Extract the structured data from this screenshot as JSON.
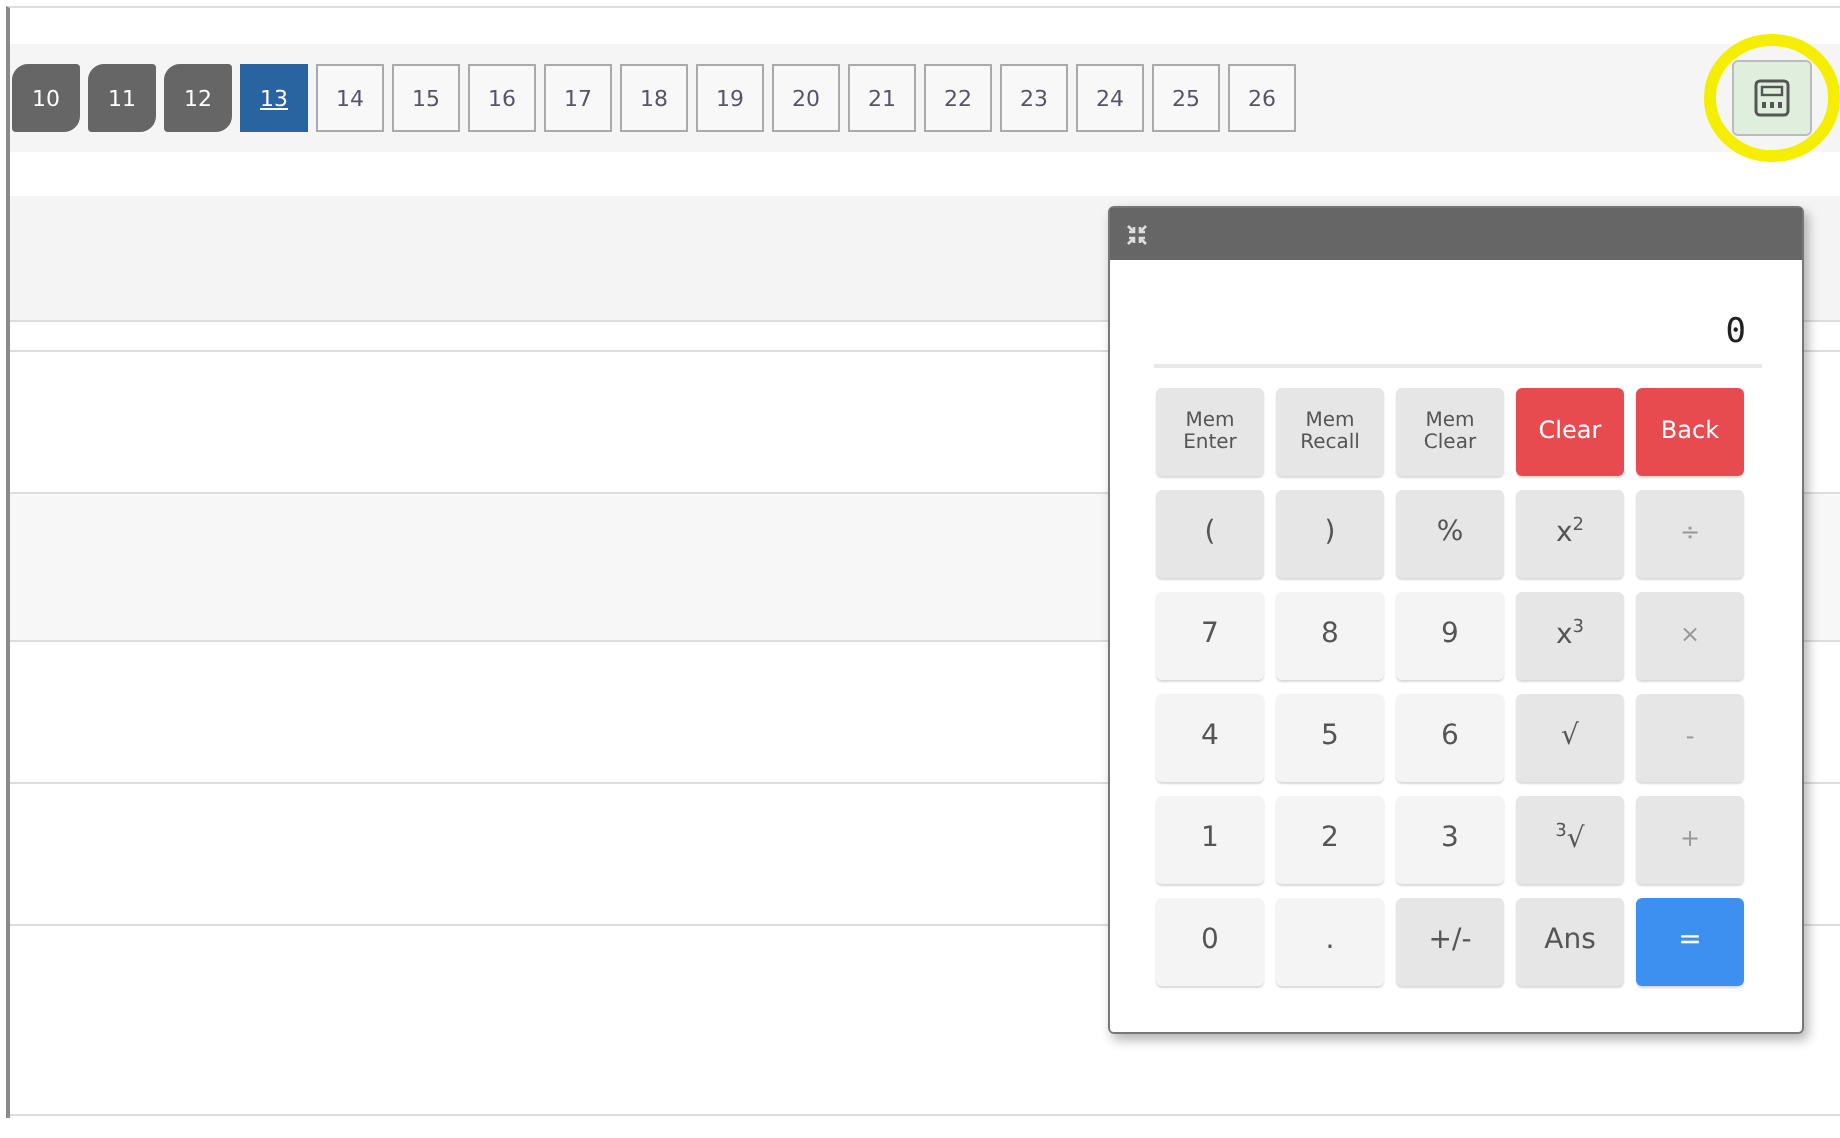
{
  "pages": [
    {
      "label": "10",
      "answered": true,
      "selected": false
    },
    {
      "label": "11",
      "answered": true,
      "selected": false
    },
    {
      "label": "12",
      "answered": true,
      "selected": false
    },
    {
      "label": "13",
      "answered": false,
      "selected": true
    },
    {
      "label": "14",
      "answered": false,
      "selected": false
    },
    {
      "label": "15",
      "answered": false,
      "selected": false
    },
    {
      "label": "16",
      "answered": false,
      "selected": false
    },
    {
      "label": "17",
      "answered": false,
      "selected": false
    },
    {
      "label": "18",
      "answered": false,
      "selected": false
    },
    {
      "label": "19",
      "answered": false,
      "selected": false
    },
    {
      "label": "20",
      "answered": false,
      "selected": false
    },
    {
      "label": "21",
      "answered": false,
      "selected": false
    },
    {
      "label": "22",
      "answered": false,
      "selected": false
    },
    {
      "label": "23",
      "answered": false,
      "selected": false
    },
    {
      "label": "24",
      "answered": false,
      "selected": false
    },
    {
      "label": "25",
      "answered": false,
      "selected": false
    },
    {
      "label": "26",
      "answered": false,
      "selected": false
    }
  ],
  "calculator_button": {
    "highlighted": true
  },
  "calculator": {
    "display": "0",
    "keys": [
      {
        "label": "Mem Enter",
        "kind": "mem"
      },
      {
        "label": "Mem Recall",
        "kind": "mem"
      },
      {
        "label": "Mem Clear",
        "kind": "mem"
      },
      {
        "label": "Clear",
        "kind": "danger"
      },
      {
        "label": "Back",
        "kind": "danger"
      },
      {
        "label": "(",
        "kind": "func"
      },
      {
        "label": ")",
        "kind": "func"
      },
      {
        "label": "%",
        "kind": "func"
      },
      {
        "label": "x$^{2}$",
        "kind": "func"
      },
      {
        "label": "÷",
        "kind": "op"
      },
      {
        "label": "7",
        "kind": "digit"
      },
      {
        "label": "8",
        "kind": "digit"
      },
      {
        "label": "9",
        "kind": "digit"
      },
      {
        "label": "x$^{3}$",
        "kind": "func"
      },
      {
        "label": "×",
        "kind": "op"
      },
      {
        "label": "4",
        "kind": "digit"
      },
      {
        "label": "5",
        "kind": "digit"
      },
      {
        "label": "6",
        "kind": "digit"
      },
      {
        "label": "√",
        "kind": "func"
      },
      {
        "label": "-",
        "kind": "op"
      },
      {
        "label": "1",
        "kind": "digit"
      },
      {
        "label": "2",
        "kind": "digit"
      },
      {
        "label": "3",
        "kind": "digit"
      },
      {
        "label": "$^{3}$√",
        "kind": "func"
      },
      {
        "label": "+",
        "kind": "op"
      },
      {
        "label": "0",
        "kind": "digit"
      },
      {
        "label": ".",
        "kind": "digit"
      },
      {
        "label": "+/-",
        "kind": "func"
      },
      {
        "label": "Ans",
        "kind": "func"
      },
      {
        "label": "=",
        "kind": "equals"
      }
    ]
  }
}
